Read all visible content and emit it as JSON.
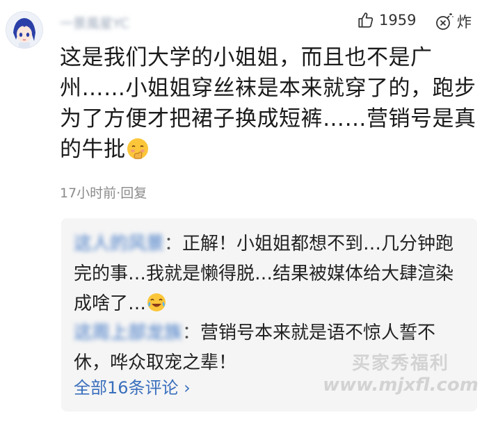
{
  "comment": {
    "username": "一景風星YC",
    "likes": "1959",
    "blast_label": "炸",
    "text": "这是我们大学的小姐姐，而且也不是广州……小姐姐穿丝袜是本来就穿了的，跑步为了方便才把裙子换成短裤……营销号是真的牛批",
    "time": "17小时前",
    "dot": "·",
    "reply_label": "回复"
  },
  "replies": [
    {
      "name": "这人的风景",
      "sep": "：",
      "text": "正解！小姐姐都想不到…几分钟跑完的事…我就是懒得脱…结果被媒体给大肆渲染成啥了…"
    },
    {
      "name": "这周上部龙族",
      "sep": "：",
      "text": "营销号本来就是语不惊人誓不休，哗众取宠之辈！"
    }
  ],
  "all_comments": "全部16条评论 ›",
  "watermark": {
    "line1": "买家秀福利",
    "line2": "www.mjxfl.com"
  },
  "icons": {
    "avatar": "anime-avatar",
    "like": "thumbs-up-icon",
    "blast": "bomb-icon",
    "emoji1": "blush-emoji-icon",
    "emoji2": "laughing-tears-emoji-icon"
  }
}
